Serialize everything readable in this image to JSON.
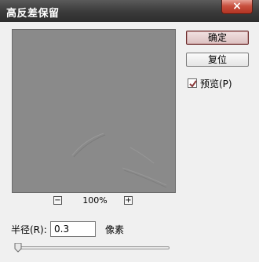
{
  "window": {
    "title": "高反差保留",
    "close_glyph": "×"
  },
  "preview": {
    "zoom_out": "−",
    "zoom_level": "100%",
    "zoom_in": "+"
  },
  "buttons": {
    "ok": "确定",
    "reset": "复位"
  },
  "preview_toggle": {
    "label": "预览(P)",
    "checked": true
  },
  "radius": {
    "label": "半径(R):",
    "value": "0.3",
    "unit": "像素",
    "slider_fraction": 0.0
  },
  "colors": {
    "accent": "#8b3a3a",
    "preview_gray": "#8a8a8a",
    "titlebar": "#3a3a3a",
    "close": "#c8503f"
  }
}
